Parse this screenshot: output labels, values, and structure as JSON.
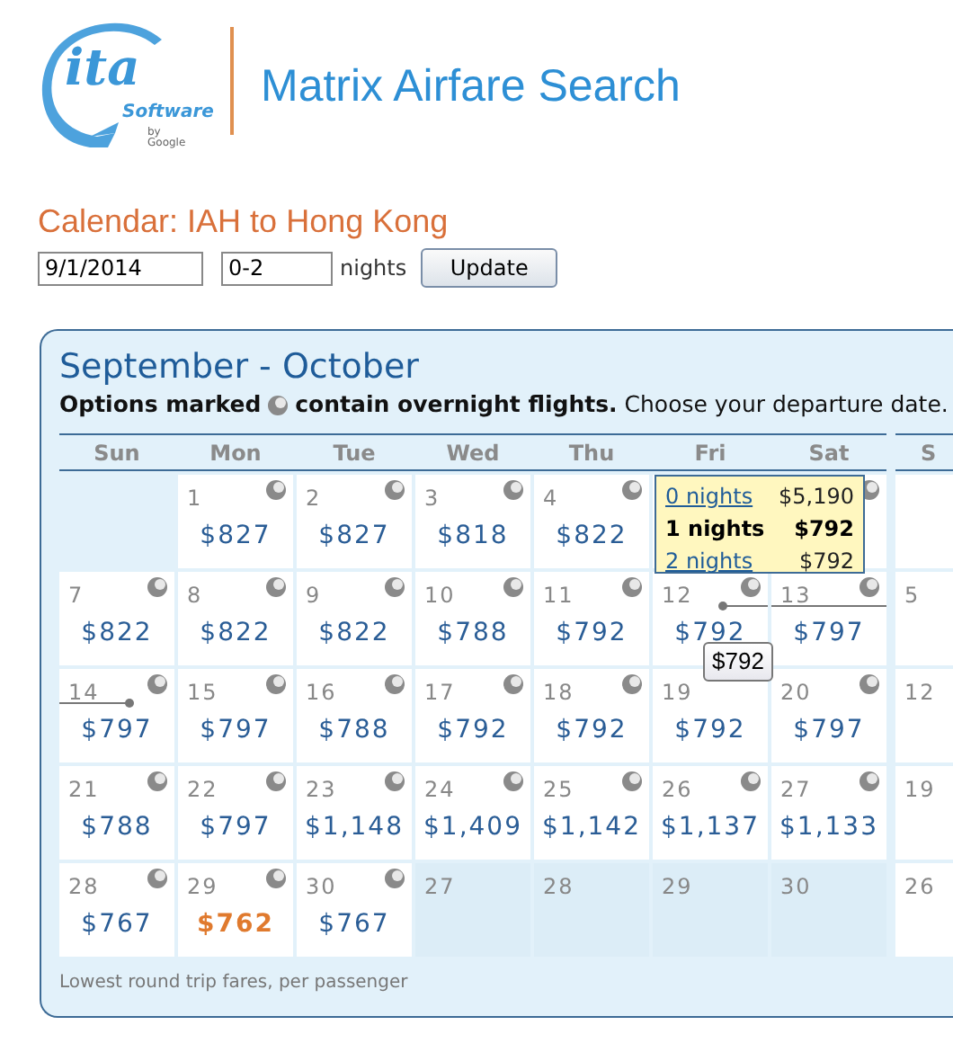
{
  "brand": {
    "name": "ita",
    "sub": "Software",
    "by": "by Google"
  },
  "app_title": "Matrix Airfare Search",
  "heading": "Calendar: IAH to Hong Kong",
  "form": {
    "date": "9/1/2014",
    "nights": "0-2",
    "nights_label": "nights",
    "button": "Update"
  },
  "calendar": {
    "title": "September - October",
    "note_before": "Options marked",
    "note_after_bold": "contain overnight flights.",
    "note_after": "Choose your departure date.",
    "weekdays": [
      "Sun",
      "Mon",
      "Tue",
      "Wed",
      "Thu",
      "Fri",
      "Sat"
    ],
    "rows": [
      [
        {
          "kind": "blank"
        },
        {
          "kind": "fare",
          "day": "1",
          "fare": "$827",
          "overnight": true
        },
        {
          "kind": "fare",
          "day": "2",
          "fare": "$827",
          "overnight": true
        },
        {
          "kind": "fare",
          "day": "3",
          "fare": "$818",
          "overnight": true
        },
        {
          "kind": "fare",
          "day": "4",
          "fare": "$822",
          "overnight": true
        },
        {
          "kind": "covered"
        },
        {
          "kind": "covered",
          "overnight": true
        }
      ],
      [
        {
          "kind": "fare",
          "day": "7",
          "fare": "$822",
          "overnight": true
        },
        {
          "kind": "fare",
          "day": "8",
          "fare": "$822",
          "overnight": true
        },
        {
          "kind": "fare",
          "day": "9",
          "fare": "$822",
          "overnight": true
        },
        {
          "kind": "fare",
          "day": "10",
          "fare": "$788",
          "overnight": true
        },
        {
          "kind": "fare",
          "day": "11",
          "fare": "$792",
          "overnight": true
        },
        {
          "kind": "fare",
          "day": "12",
          "fare": "$792",
          "overnight": true,
          "trip_start": true
        },
        {
          "kind": "fare",
          "day": "13",
          "fare": "$797",
          "overnight": true,
          "trip_mid": true
        }
      ],
      [
        {
          "kind": "fare",
          "day": "14",
          "fare": "$797",
          "overnight": true,
          "trip_end": true
        },
        {
          "kind": "fare",
          "day": "15",
          "fare": "$797",
          "overnight": true
        },
        {
          "kind": "fare",
          "day": "16",
          "fare": "$788",
          "overnight": true
        },
        {
          "kind": "fare",
          "day": "17",
          "fare": "$792",
          "overnight": true
        },
        {
          "kind": "fare",
          "day": "18",
          "fare": "$792",
          "overnight": true
        },
        {
          "kind": "fare",
          "day": "19",
          "fare": "$792",
          "overnight": false
        },
        {
          "kind": "fare",
          "day": "20",
          "fare": "$797",
          "overnight": true
        }
      ],
      [
        {
          "kind": "fare",
          "day": "21",
          "fare": "$788",
          "overnight": true
        },
        {
          "kind": "fare",
          "day": "22",
          "fare": "$797",
          "overnight": true
        },
        {
          "kind": "fare",
          "day": "23",
          "fare": "$1,148",
          "overnight": true
        },
        {
          "kind": "fare",
          "day": "24",
          "fare": "$1,409",
          "overnight": true
        },
        {
          "kind": "fare",
          "day": "25",
          "fare": "$1,142",
          "overnight": true
        },
        {
          "kind": "fare",
          "day": "26",
          "fare": "$1,137",
          "overnight": true
        },
        {
          "kind": "fare",
          "day": "27",
          "fare": "$1,133",
          "overnight": true
        }
      ],
      [
        {
          "kind": "fare",
          "day": "28",
          "fare": "$767",
          "overnight": true
        },
        {
          "kind": "fare",
          "day": "29",
          "fare": "$762",
          "overnight": true,
          "lowest": true
        },
        {
          "kind": "fare",
          "day": "30",
          "fare": "$767",
          "overnight": true
        },
        {
          "kind": "other_month",
          "day": "27"
        },
        {
          "kind": "other_month",
          "day": "28"
        },
        {
          "kind": "other_month",
          "day": "29"
        },
        {
          "kind": "other_month",
          "day": "30"
        }
      ]
    ],
    "next_month": {
      "weekday": "S",
      "cells": [
        {
          "kind": "blank"
        },
        {
          "kind": "day",
          "day": "5"
        },
        {
          "kind": "day",
          "day": "12"
        },
        {
          "kind": "day",
          "day": "19"
        },
        {
          "kind": "day",
          "day": "26"
        }
      ]
    },
    "popup": {
      "options": [
        {
          "label": "0 nights",
          "fare": "$5,190",
          "selected": false
        },
        {
          "label": "1 nights",
          "fare": "$792",
          "selected": true
        },
        {
          "label": "2 nights",
          "fare": "$792",
          "selected": false
        }
      ]
    },
    "tooltip": "$792",
    "footer": "Lowest round trip fares, per passenger"
  }
}
